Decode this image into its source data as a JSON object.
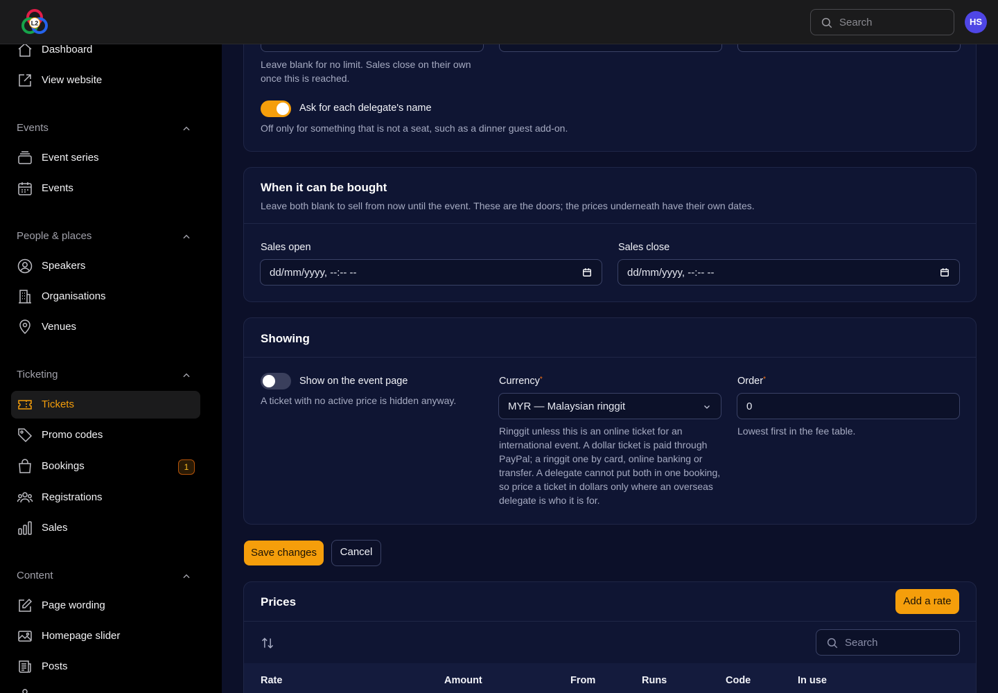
{
  "app": {
    "logo_text": "L2",
    "search_placeholder": "Search",
    "avatar_initials": "HS"
  },
  "sidebar": {
    "top_items": [
      {
        "label": "Dashboard",
        "icon": "home-icon"
      },
      {
        "label": "View website",
        "icon": "external-edit-icon"
      }
    ],
    "groups": [
      {
        "label": "Events",
        "items": [
          {
            "label": "Event series",
            "icon": "stack-icon"
          },
          {
            "label": "Events",
            "icon": "calendar-icon"
          }
        ]
      },
      {
        "label": "People & places",
        "items": [
          {
            "label": "Speakers",
            "icon": "user-circle-icon"
          },
          {
            "label": "Organisations",
            "icon": "building-icon"
          },
          {
            "label": "Venues",
            "icon": "map-pin-icon"
          }
        ]
      },
      {
        "label": "Ticketing",
        "items": [
          {
            "label": "Tickets",
            "icon": "ticket-icon",
            "active": true
          },
          {
            "label": "Promo codes",
            "icon": "tag-icon"
          },
          {
            "label": "Bookings",
            "icon": "shopping-bag-icon",
            "badge": "1"
          },
          {
            "label": "Registrations",
            "icon": "user-group-icon"
          },
          {
            "label": "Sales",
            "icon": "chart-bar-icon"
          }
        ]
      },
      {
        "label": "Content",
        "items": [
          {
            "label": "Page wording",
            "icon": "pencil-square-icon"
          },
          {
            "label": "Homepage slider",
            "icon": "photo-icon"
          },
          {
            "label": "Posts",
            "icon": "newspaper-icon"
          }
        ]
      }
    ]
  },
  "capacity": {
    "help": "Leave blank for no limit. Sales close on their own once this is reached.",
    "ask_name_label": "Ask for each delegate's name",
    "ask_name_on": true,
    "ask_name_help": "Off only for something that is not a seat, such as a dinner guest add-on."
  },
  "when": {
    "title": "When it can be bought",
    "description": "Leave both blank to sell from now until the event. These are the doors; the prices underneath have their own dates.",
    "sales_open_label": "Sales open",
    "sales_open_value": "dd/mm/yyyy, --:-- --",
    "sales_close_label": "Sales close",
    "sales_close_value": "dd/mm/yyyy, --:-- --"
  },
  "showing": {
    "title": "Showing",
    "show_label": "Show on the event page",
    "show_on": false,
    "show_help": "A ticket with no active price is hidden anyway.",
    "currency_label": "Currency",
    "currency_value": "MYR — Malaysian ringgit",
    "currency_help": "Ringgit unless this is an online ticket for an international event. A dollar ticket is paid through PayPal; a ringgit one by card, online banking or transfer. A delegate cannot put both in one booking, so price a ticket in dollars only where an overseas delegate is who it is for.",
    "order_label": "Order",
    "order_value": "0",
    "order_help": "Lowest first in the fee table.",
    "required_marker": "*"
  },
  "actions": {
    "save": "Save changes",
    "cancel": "Cancel"
  },
  "prices": {
    "title": "Prices",
    "add_button": "Add a rate",
    "search_placeholder": "Search",
    "columns": [
      "Rate",
      "Amount",
      "From",
      "Runs",
      "Code",
      "In use"
    ]
  },
  "colors": {
    "accent": "#f59e0b",
    "avatar": "#4f46e5",
    "card": "#0f1533",
    "background": "#0c1029"
  }
}
